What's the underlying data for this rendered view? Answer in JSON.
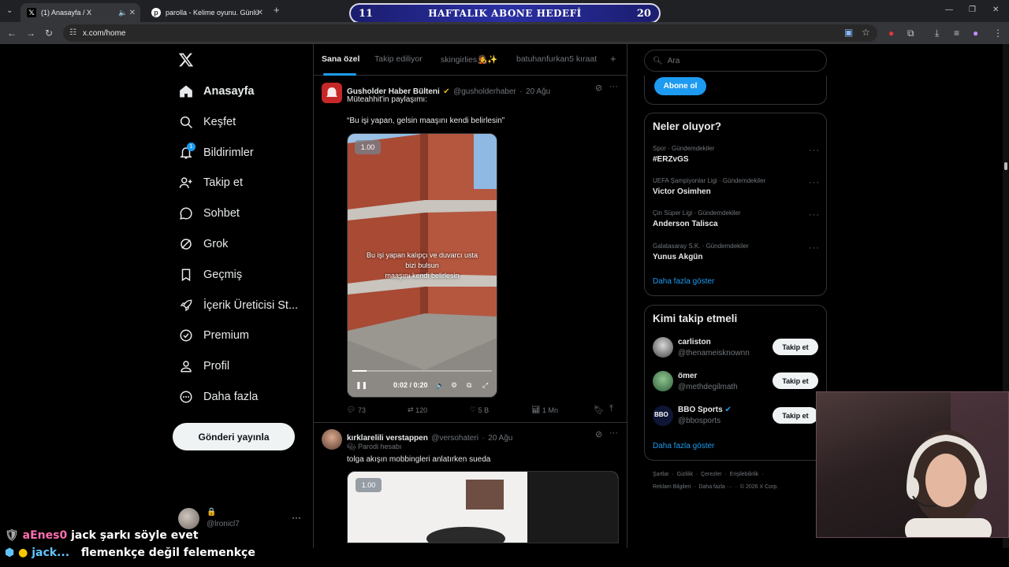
{
  "browser": {
    "tabs": [
      {
        "title": "(1) Anasayfa / X",
        "active": true
      },
      {
        "title": "parolla - Kelime oyunu. Günlük",
        "active": false
      }
    ],
    "url": "x.com/home"
  },
  "stream_overlay": {
    "goal_label": "HAFTALIK ABONE HEDEFİ",
    "goal_current": "11",
    "goal_target": "20",
    "chat": [
      {
        "user": "aEnes0",
        "message": "jack şarkı söyle evet"
      },
      {
        "user": "jack...",
        "message": "flemenkçe değil felemenkçe"
      }
    ]
  },
  "nav": {
    "items": [
      {
        "label": "Anasayfa",
        "icon": "home-icon",
        "active": true
      },
      {
        "label": "Keşfet",
        "icon": "search-icon"
      },
      {
        "label": "Bildirimler",
        "icon": "bell-icon",
        "badge": "1"
      },
      {
        "label": "Takip et",
        "icon": "add-user-icon"
      },
      {
        "label": "Sohbet",
        "icon": "chat-icon"
      },
      {
        "label": "Grok",
        "icon": "grok-icon"
      },
      {
        "label": "Geçmiş",
        "icon": "bookmark-icon"
      },
      {
        "label": "İçerik Üreticisi St...",
        "icon": "rocket-icon"
      },
      {
        "label": "Premium",
        "icon": "verified-icon"
      },
      {
        "label": "Profil",
        "icon": "profile-icon"
      },
      {
        "label": "Daha fazla",
        "icon": "more-circle-icon"
      }
    ],
    "post_button": "Gönderi yayınla",
    "account_handle": "@lronicl7"
  },
  "feed": {
    "tabs": [
      "Sana özel",
      "Takip ediliyor",
      "skingirlies🧑‍🎤✨",
      "batuhanfurkan5 kıraat"
    ],
    "tweets": [
      {
        "name": "Gusholder Haber Bülteni",
        "handle": "@gusholderhaber",
        "date": "20 Ağu",
        "line1": "Müteahhit'in paylaşımı:",
        "line2": "“Bu işi yapan, gelsin maaşını kendi belirlesin”",
        "video": {
          "speed": "1.00",
          "caption1": "Bu işi yapan kalıpçı ve duvarcı usta",
          "caption2": "bizi bulsun",
          "caption3": "maaşını kendi belirlesin",
          "time": "0:02 / 0:20",
          "progress": 0.1
        },
        "replies": "73",
        "reposts": "120",
        "likes": "5 B",
        "views": "1 Mn"
      },
      {
        "name": "kırklarelili verstappen",
        "handle": "@versohateri",
        "date": "20 Ağu",
        "label": "Parodi hesabı",
        "text": "tolga akışın mobbingleri anlatırken sueda",
        "video_speed": "1.00"
      }
    ]
  },
  "sidebar": {
    "search_placeholder": "Ara",
    "subscribe": "Abone ol",
    "trends_title": "Neler oluyor?",
    "trends": [
      {
        "context": "Spor · Gündemdekiler",
        "name": "#ERZvGS"
      },
      {
        "context": "UEFA Şampiyonlar Ligi · Gündemdekiler",
        "name": "Victor Osimhen"
      },
      {
        "context": "Çin Süper Ligi · Gündemdekiler",
        "name": "Anderson Talisca"
      },
      {
        "context": "Galatasaray S.K. · Gündemdekiler",
        "name": "Yunus Akgün"
      }
    ],
    "show_more": "Daha fazla göster",
    "who_title": "Kimi takip etmeli",
    "who": [
      {
        "name": "carliston",
        "handle": "@thenameisknownn"
      },
      {
        "name": "ömer",
        "handle": "@methdegilmath"
      },
      {
        "name": "BBO Sports",
        "handle": "@bbosports",
        "verified": true
      }
    ],
    "follow_label": "Takip et",
    "footer1": [
      "Şartlar",
      "Gizlilik",
      "Çerezler",
      "Erişilebilirlik"
    ],
    "footer2": [
      "Reklam Bilgileri",
      "Daha fazla ···",
      "© 2026 X Corp."
    ]
  }
}
